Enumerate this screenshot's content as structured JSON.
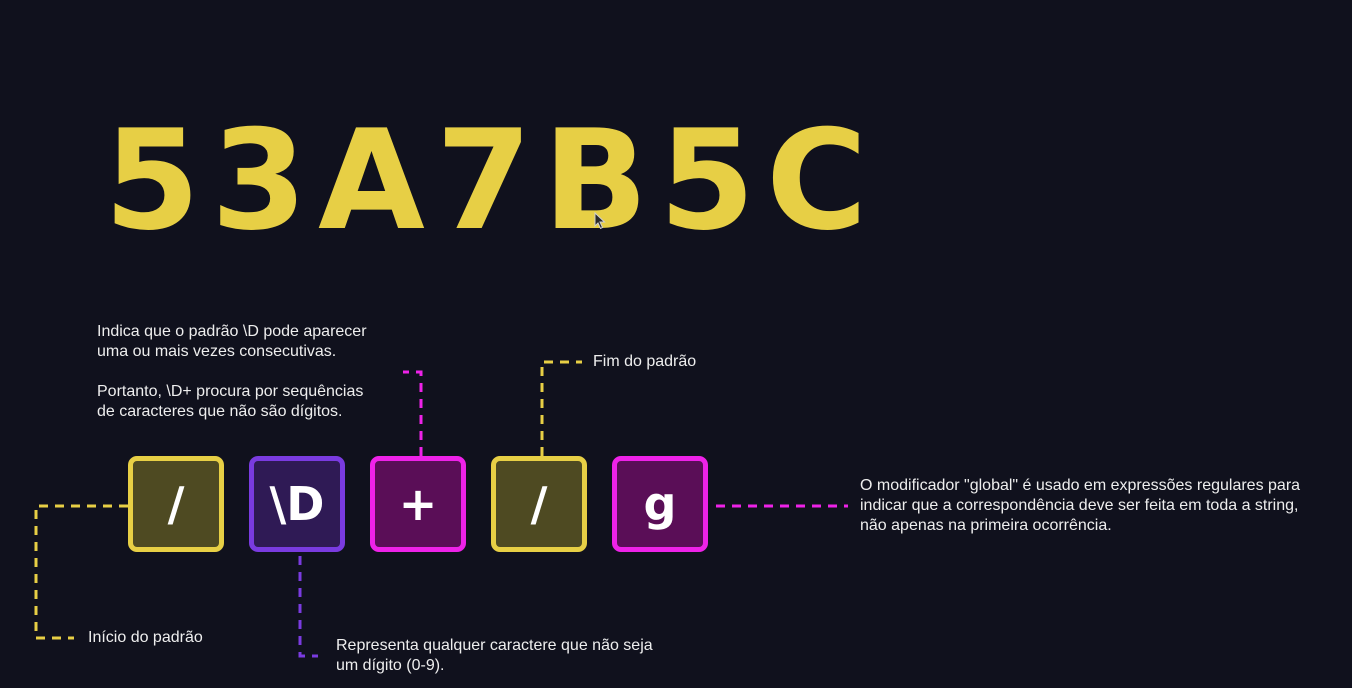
{
  "headline": "53A7B5C",
  "tokens": {
    "open_slash": "/",
    "non_digit": "\\D",
    "plus": "+",
    "close_slash": "/",
    "global_flag": "g"
  },
  "annotations": {
    "plus_line1": "Indica que o padrão \\D pode aparecer",
    "plus_line2": "uma ou mais vezes consecutivas.",
    "plus_line3": "Portanto, \\D+ procura por sequências",
    "plus_line4": "de caracteres que não são dígitos.",
    "end_pattern": "Fim do padrão",
    "global_line1": "O modificador \"global\" é usado em expressões regulares para",
    "global_line2": "indicar que a correspondência deve ser feita em toda a string,",
    "global_line3": "não apenas na primeira ocorrência.",
    "start_pattern": "Início do padrão",
    "non_digit_line1": "Representa qualquer caractere que não seja",
    "non_digit_line2": "um dígito (0-9)."
  },
  "colors": {
    "background": "#10111d",
    "yellow": "#e7cf45",
    "purple": "#7a3be0",
    "magenta": "#ee22e8"
  },
  "icons": {
    "cursor": "mouse-pointer-icon"
  }
}
